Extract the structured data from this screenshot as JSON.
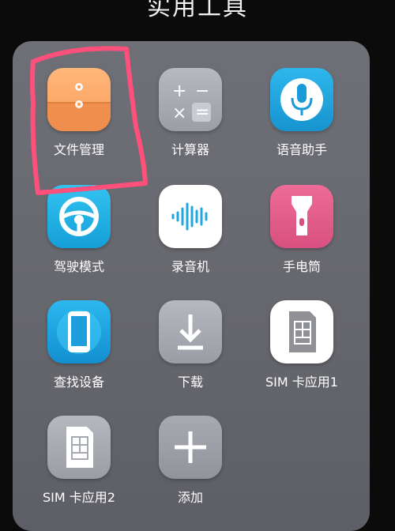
{
  "folder": {
    "title": "实用工具"
  },
  "apps": [
    {
      "label": "文件管理",
      "icon": "file-manager-icon",
      "color": "#f6a15f"
    },
    {
      "label": "计算器",
      "icon": "calculator-icon",
      "color": "#a9abb3"
    },
    {
      "label": "语音助手",
      "icon": "microphone-icon",
      "color": "#23a7e0"
    },
    {
      "label": "驾驶模式",
      "icon": "steering-wheel-icon",
      "color": "#1eb6e8"
    },
    {
      "label": "录音机",
      "icon": "sound-wave-icon",
      "color": "#ffffff"
    },
    {
      "label": "手电筒",
      "icon": "flashlight-icon",
      "color": "#e25f8e"
    },
    {
      "label": "查找设备",
      "icon": "phone-icon",
      "color": "#17a6e4"
    },
    {
      "label": "下载",
      "icon": "download-icon",
      "color": "#a9abb3"
    },
    {
      "label": "SIM 卡应用1",
      "icon": "sim-card-icon",
      "color": "#ffffff"
    },
    {
      "label": "SIM 卡应用2",
      "icon": "sim-card-icon",
      "color": "#a9abb3"
    },
    {
      "label": "添加",
      "icon": "plus-icon",
      "color": "#9d9ea5"
    }
  ],
  "annotation": {
    "color": "#ff4f7b",
    "target": "文件管理"
  }
}
